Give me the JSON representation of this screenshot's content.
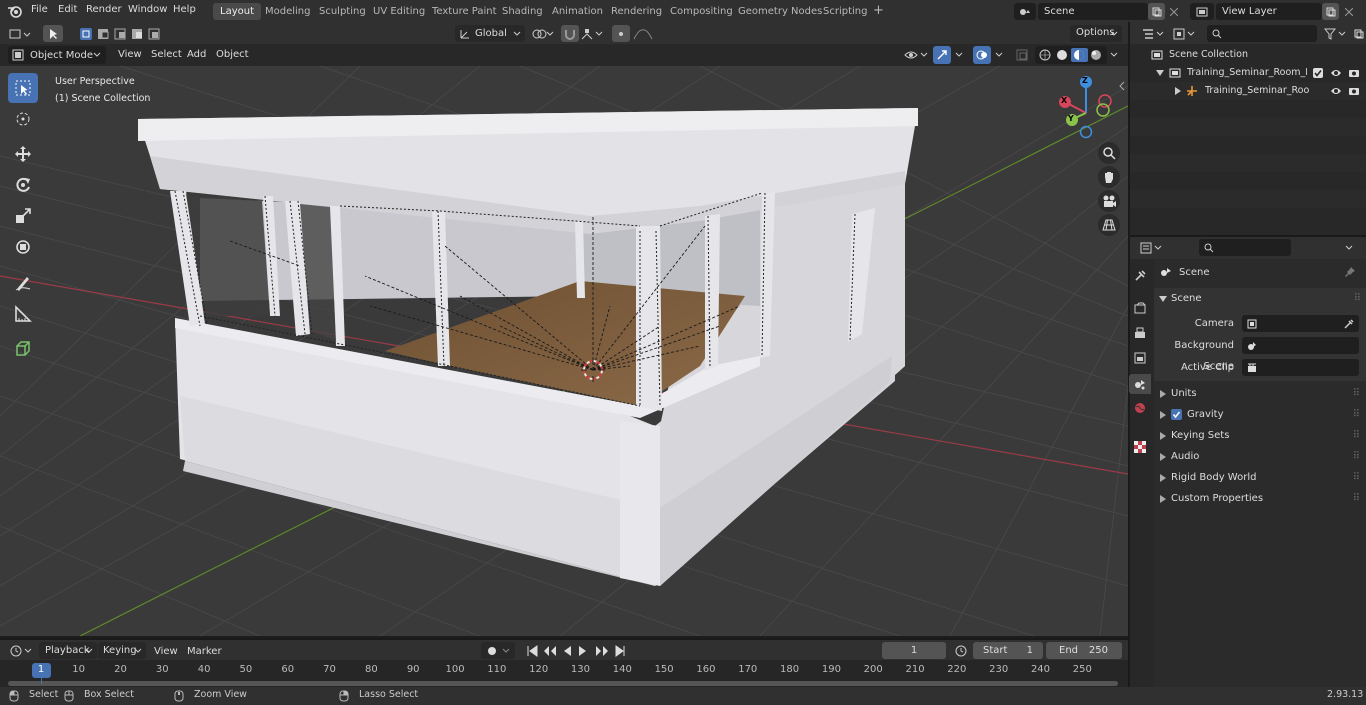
{
  "topbar": {
    "menus": [
      "File",
      "Edit",
      "Render",
      "Window",
      "Help"
    ],
    "workspaces": [
      "Layout",
      "Modeling",
      "Sculpting",
      "UV Editing",
      "Texture Paint",
      "Shading",
      "Animation",
      "Rendering",
      "Compositing",
      "Geometry Nodes",
      "Scripting"
    ],
    "active_workspace": "Layout",
    "add_tab": "+",
    "scene": "Scene",
    "view_layer": "View Layer"
  },
  "viewport_header": {
    "mode": "Object Mode",
    "menus": [
      "View",
      "Select",
      "Add",
      "Object"
    ],
    "transform_orientation": "Global",
    "options": "Options"
  },
  "viewport": {
    "perspective_label": "User Perspective",
    "collection_label": "(1) Scene Collection",
    "gizmo_axes": {
      "x": "X",
      "y": "Y",
      "z": "Z"
    },
    "axis_colors": {
      "x": "#d9455a",
      "y": "#8bc34a",
      "z": "#3f8fe0"
    }
  },
  "toolbar": {
    "tools": [
      "select-box-tool",
      "cursor-tool",
      "move-tool",
      "rotate-tool",
      "scale-tool",
      "transform-tool",
      "annotate-tool",
      "measure-tool",
      "add-cube-tool"
    ],
    "active_tool": "select-box-tool"
  },
  "outliner": {
    "search_placeholder": "",
    "root": "Scene Collection",
    "items": [
      {
        "label": "Training_Seminar_Room_Emp",
        "depth": 1
      },
      {
        "label": "Training_Seminar_Room_",
        "depth": 2
      }
    ]
  },
  "properties": {
    "breadcrumb": "Scene",
    "panel": "Scene",
    "fields": [
      {
        "label": "Camera",
        "value": ""
      },
      {
        "label": "Background Scene",
        "value": ""
      },
      {
        "label": "Active Clip",
        "value": ""
      }
    ],
    "sections": [
      "Units",
      "Gravity",
      "Keying Sets",
      "Audio",
      "Rigid Body World",
      "Custom Properties"
    ],
    "gravity_checked": true
  },
  "timeline": {
    "menus": [
      "Playback",
      "Keying",
      "View",
      "Marker"
    ],
    "current_frame": "1",
    "start_label": "Start",
    "start": "1",
    "end_label": "End",
    "end": "250",
    "ticks": [
      "1",
      "10",
      "20",
      "30",
      "40",
      "50",
      "60",
      "70",
      "80",
      "90",
      "100",
      "110",
      "120",
      "130",
      "140",
      "150",
      "160",
      "170",
      "180",
      "190",
      "200",
      "210",
      "220",
      "230",
      "240",
      "250"
    ]
  },
  "statusbar": {
    "items": [
      "Select",
      "Box Select",
      "Zoom View",
      "Lasso Select"
    ],
    "version": "2.93.13"
  }
}
